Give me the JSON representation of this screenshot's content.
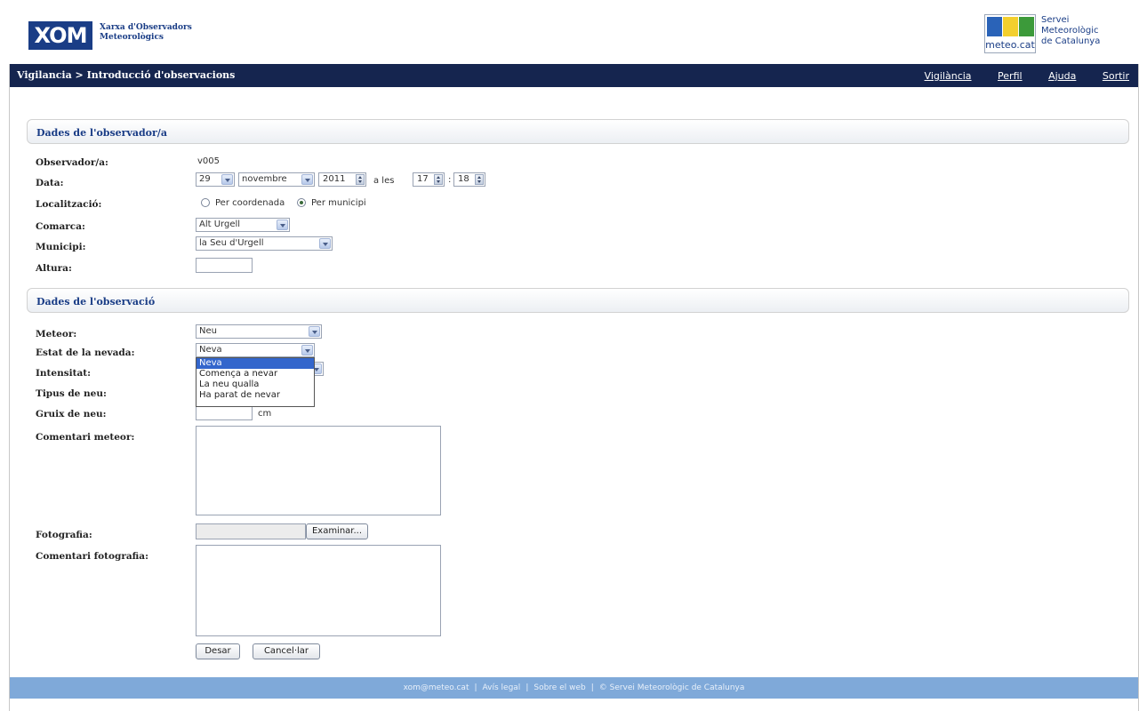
{
  "header": {
    "logo_text": "XOM",
    "logo_sub": [
      "Xarxa d'Observadors",
      "Meteorològics"
    ],
    "smc_logo_text": "meteo.cat",
    "smc_sub": [
      "Servei",
      "Meteorològic",
      "de Catalunya"
    ]
  },
  "nav": {
    "breadcrumb": "Vigilancia > Introducció d'observacions",
    "links": [
      "Vigilància",
      "Perfil",
      "Ajuda",
      "Sortir"
    ]
  },
  "observer_section": {
    "title": "Dades de l'observador/a",
    "labels": {
      "observer": "Observador/a:",
      "date": "Data:",
      "location": "Localització:",
      "county": "Comarca:",
      "municipality": "Municipi:",
      "altitude": "Altura:"
    },
    "observer_value": "v005",
    "date": {
      "day": "29",
      "month": "novembre",
      "year": "2011",
      "at_label": "a les",
      "hour": "17",
      "time_sep": ":",
      "minute": "18"
    },
    "location_options": [
      "Per coordenada",
      "Per municipi"
    ],
    "location_selected": "Per municipi",
    "county_value": "Alt Urgell",
    "municipality_value": "la Seu d'Urgell",
    "altitude_value": ""
  },
  "observation_section": {
    "title": "Dades de l'observació",
    "labels": {
      "meteor": "Meteor:",
      "snow_state": "Estat de la nevada:",
      "intensity": "Intensitat:",
      "snow_type": "Tipus de neu:",
      "snow_depth": "Gruix de neu:",
      "meteor_comment": "Comentari meteor:",
      "photo": "Fotografia:",
      "photo_comment": "Comentari fotografia:"
    },
    "meteor_value": "Neu",
    "snow_state_value": "Neva",
    "snow_state_options": [
      "Neva",
      "Comença a nevar",
      "La neu qualla",
      "Ha parat de nevar"
    ],
    "snow_depth_unit": "cm",
    "browse_label": "Examinar...",
    "save_label": "Desar",
    "cancel_label": "Cancel·lar"
  },
  "footer": {
    "items": [
      "xom@meteo.cat",
      "Avís legal",
      "Sobre el web",
      "© Servei Meteorològic de Catalunya"
    ]
  }
}
